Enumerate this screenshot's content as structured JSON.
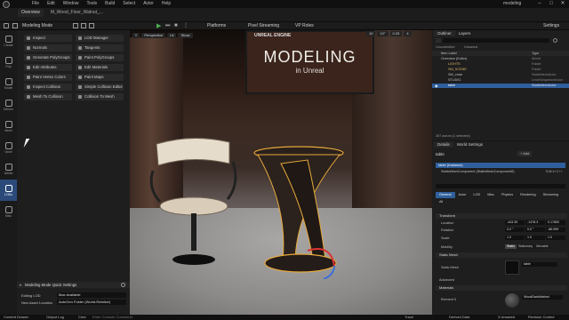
{
  "title_bar": {
    "menu": [
      "File",
      "Edit",
      "Window",
      "Tools",
      "Build",
      "Select",
      "Actor",
      "Help"
    ],
    "app_name": "modeling"
  },
  "toolbar": {
    "level_tab": "Overview",
    "file_tab": "M_Wood_Floor_Walnut_...",
    "mode_label": "Modeling Mode",
    "platforms_label": "Platforms",
    "pixel_streaming_label": "Pixel Streaming",
    "vp_roles_label": "VP Roles",
    "settings_label": "Settings"
  },
  "rail": {
    "items": [
      {
        "label": "Select"
      },
      {
        "label": "Create"
      },
      {
        "label": "PolyEdit"
      },
      {
        "label": "TriModel"
      },
      {
        "label": "Deform"
      },
      {
        "label": "Transform"
      },
      {
        "label": "MeshOps"
      },
      {
        "label": "VoxOps"
      },
      {
        "label": "Attributes"
      },
      {
        "label": "UVs"
      },
      {
        "label": "Baking"
      },
      {
        "label": "LODs"
      }
    ],
    "rail_labels": [
      "Create",
      "Poly",
      "Model",
      "Deform",
      "Mesh",
      "Voxel",
      "Attribs",
      "UVs",
      "Bake",
      "LODs",
      "Misc"
    ]
  },
  "tool_panel": {
    "buttons_left": [
      "Inspect",
      "Normals",
      "Generate PolyGroups",
      "Edit Attributes",
      "Paint Vertex Colors",
      "Inspect Collision",
      "Mesh To Collision"
    ],
    "buttons_right": [
      "LOD Manager",
      "Tangents",
      "Paint PolyGroups",
      "Edit Materials",
      "Paint Maps",
      "Simple Collision Editor",
      "Collision To Mesh"
    ],
    "quick_settings_title": "Modeling Mode Quick Settings",
    "editing_lod_label": "Editing LOD",
    "editing_lod_value": "Max Available",
    "new_asset_location_label": "New Asset Location",
    "new_asset_location_value": "AutoGen Folder (World-Relative)"
  },
  "viewport": {
    "perspective_label": "Perspective",
    "lit_label": "Lit",
    "show_label": "Show",
    "grid_value": "10",
    "angle_value": "10°",
    "scale_value": "0.25",
    "camera_value": "4",
    "screen_title": "MODELING",
    "screen_subtitle": "in Unreal",
    "screen_logo": "UNREAL ENGINE"
  },
  "outliner": {
    "tab_label": "Outliner",
    "layers_tab": "Layers",
    "filter_unsaved": "Uncontrolled",
    "filter_unsaved2": "Unsaved",
    "col_item": "Item Label",
    "col_type": "Type",
    "rows": [
      {
        "label": "Overview (Editor)",
        "type": "World"
      },
      {
        "label": "LIGHTS",
        "type": "Folder"
      },
      {
        "label": "SM_SCENE",
        "type": "Folder"
      },
      {
        "label": "SM_chair",
        "type": "StaticMeshActor"
      },
      {
        "label": "STUDIO",
        "type": "LevelSequenceActor"
      },
      {
        "label": "table",
        "type": "StaticMeshActor"
      }
    ],
    "footer": "357 actors (1 selected)"
  },
  "details": {
    "tab_label": "Details",
    "world_settings_tab": "World Settings",
    "actor_name": "table",
    "add_label": "+ Add",
    "instance_label": "table (Instance)",
    "component_label": "StaticMeshComponent (StaticMeshComponent0)",
    "edit_in_cpp": "Edit in C++",
    "filter_tabs": [
      "General",
      "Actor",
      "LOD",
      "Misc",
      "Physics",
      "Rendering",
      "Streaming",
      "All"
    ],
    "transform_header": "Transform",
    "location_label": "Location",
    "location_values": [
      "-443.39",
      "-1478.3",
      "0.17800"
    ],
    "rotation_label": "Rotation",
    "rotation_values": [
      "0.0 °",
      "0.0 °",
      "-86.999"
    ],
    "scale_label": "Scale",
    "scale_values": [
      "1.0",
      "1.0",
      "1.0"
    ],
    "mobility_label": "Mobility",
    "mobility_options": [
      "Static",
      "Stationary",
      "Movable"
    ],
    "static_mesh_header": "Static Mesh",
    "static_mesh_label": "Static Mesh",
    "static_mesh_value": "table",
    "advanced_label": "Advanced",
    "materials_header": "Materials",
    "element_label": "Element 0",
    "material_value": "WoodDarkMatInst"
  },
  "status_bar": {
    "content_drawer": "Content Drawer",
    "output_log": "Output Log",
    "cmd": "Cmd",
    "cmd_placeholder": "Enter Console Command",
    "trace": "Trace",
    "derived_data": "Derived Data",
    "unsaved": "3 Unsaved",
    "revision_control": "Revision Control"
  }
}
